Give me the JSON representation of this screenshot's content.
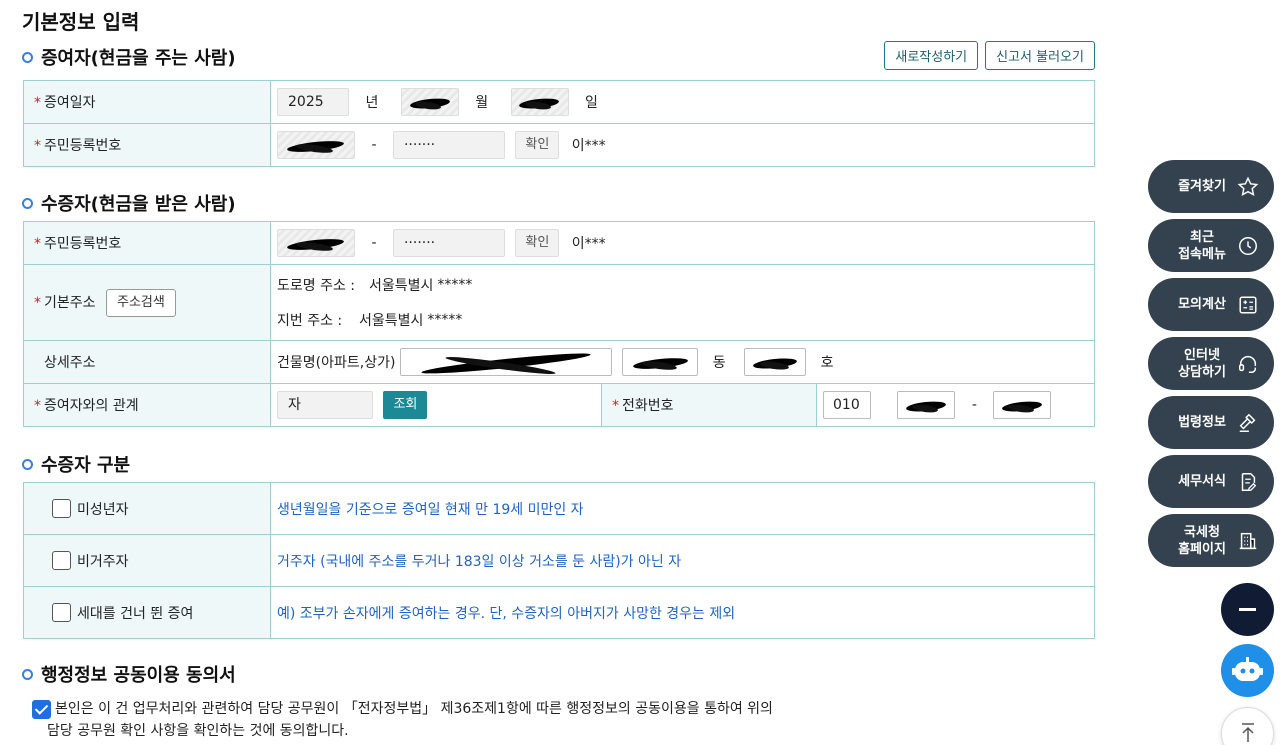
{
  "page_title": "기본정보 입력",
  "donor": {
    "title": "증여자(현금을 주는 사람)",
    "new_btn": "새로작성하기",
    "load_btn": "신고서 불러오기",
    "date_label": "증여일자",
    "year": "2025",
    "year_unit": "년",
    "month_unit": "월",
    "day_unit": "일",
    "rrn_label": "주민등록번호",
    "rrn_back": "·······",
    "confirm_btn": "확인",
    "name": "이***"
  },
  "recipient": {
    "title": "수증자(현금을 받은 사람)",
    "rrn_label": "주민등록번호",
    "rrn_back": "·······",
    "confirm_btn": "확인",
    "name": "이***",
    "addr_label": "기본주소",
    "addr_search_btn": "주소검색",
    "road_key": "도로명 주소 :",
    "road_val": "서울특별시",
    "road_mask": "*****",
    "lot_key": "지번 주소 :",
    "lot_val": "서울특별시",
    "lot_mask": "*****",
    "detail_label": "상세주소",
    "building_label": "건물명(아파트,상가)",
    "dong_unit": "동",
    "ho_unit": "호",
    "relation_label": "증여자와의 관계",
    "relation_value": "자",
    "lookup_btn": "조회",
    "phone_label": "전화번호",
    "phone_prefix": "010"
  },
  "recipient_type": {
    "title": "수증자 구분",
    "rows": [
      {
        "label": "미성년자",
        "desc": "생년월일을 기준으로 증여일 현재 만 19세 미만인 자"
      },
      {
        "label": "비거주자",
        "desc": "거주자 (국내에 주소를 두거나 183일 이상 거소를 둔 사람)가 아닌 자"
      },
      {
        "label": "세대를 건너 뛴 증여",
        "desc": "예) 조부가 손자에게 증여하는 경우. 단, 수증자의 아버지가 사망한 경우는 제외"
      }
    ]
  },
  "consent": {
    "title": "행정정보 공동이용 동의서",
    "line1": "본인은 이 건 업무처리와 관련하여 담당 공무원이 「전자정부법」 제36조제1항에 따른 행정정보의 공동이용을 통하여 위의",
    "line2": "담당 공무원 확인 사항을 확인하는 것에 동의합니다."
  },
  "dock": {
    "favorites": "즐겨찾기",
    "recent_1": "최근",
    "recent_2": "접속메뉴",
    "calc": "모의계산",
    "chat_1": "인터넷",
    "chat_2": "상담하기",
    "law": "법령정보",
    "forms": "세무서식",
    "home_1": "국세청",
    "home_2": "홈페이지"
  },
  "colors": {
    "accent": "#1c8a96",
    "bullet": "#3b7de0",
    "dock": "#34424f",
    "link_text": "#1f64c4"
  }
}
